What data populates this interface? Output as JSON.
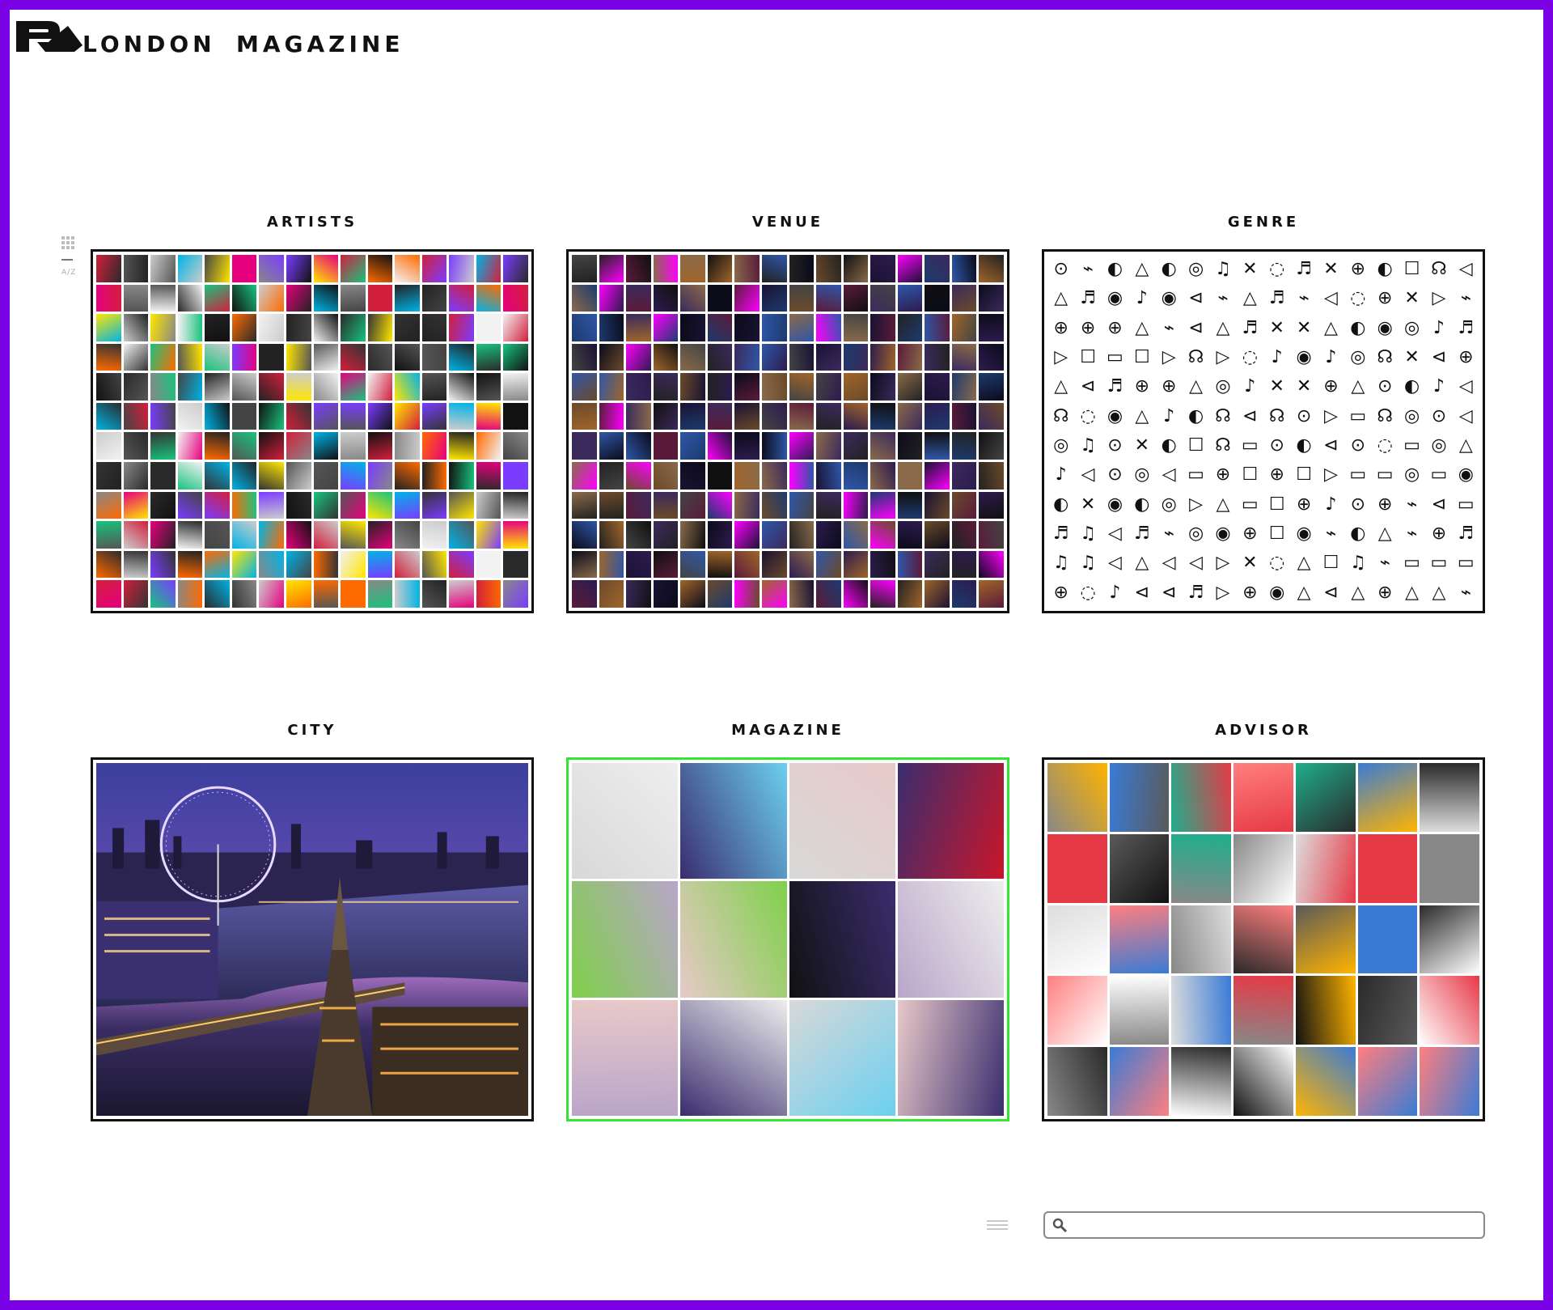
{
  "header": {
    "logo_icon": "ra-logo-icon",
    "nav": [
      {
        "label": "LONDON"
      },
      {
        "label": "MAGAZINE"
      }
    ]
  },
  "side_controls": {
    "grid_icon": "grid-view-icon",
    "sort_label": "A/Z"
  },
  "sections": [
    {
      "title": "ARTISTS",
      "type": "mosaic-small"
    },
    {
      "title": "VENUE",
      "type": "mosaic-small"
    },
    {
      "title": "GENRE",
      "type": "icon-grid"
    },
    {
      "title": "CITY",
      "type": "image"
    },
    {
      "title": "MAGAZINE",
      "type": "mosaic-large"
    },
    {
      "title": "ADVISOR",
      "type": "mosaic-medium"
    }
  ],
  "colors": {
    "frame": "#7a00e6",
    "active_border": "#33e633",
    "tile_border": "#111111"
  },
  "footer": {
    "menu_icon": "hamburger-menu-icon",
    "search_icon": "search-icon",
    "search_placeholder": "",
    "search_value": ""
  }
}
